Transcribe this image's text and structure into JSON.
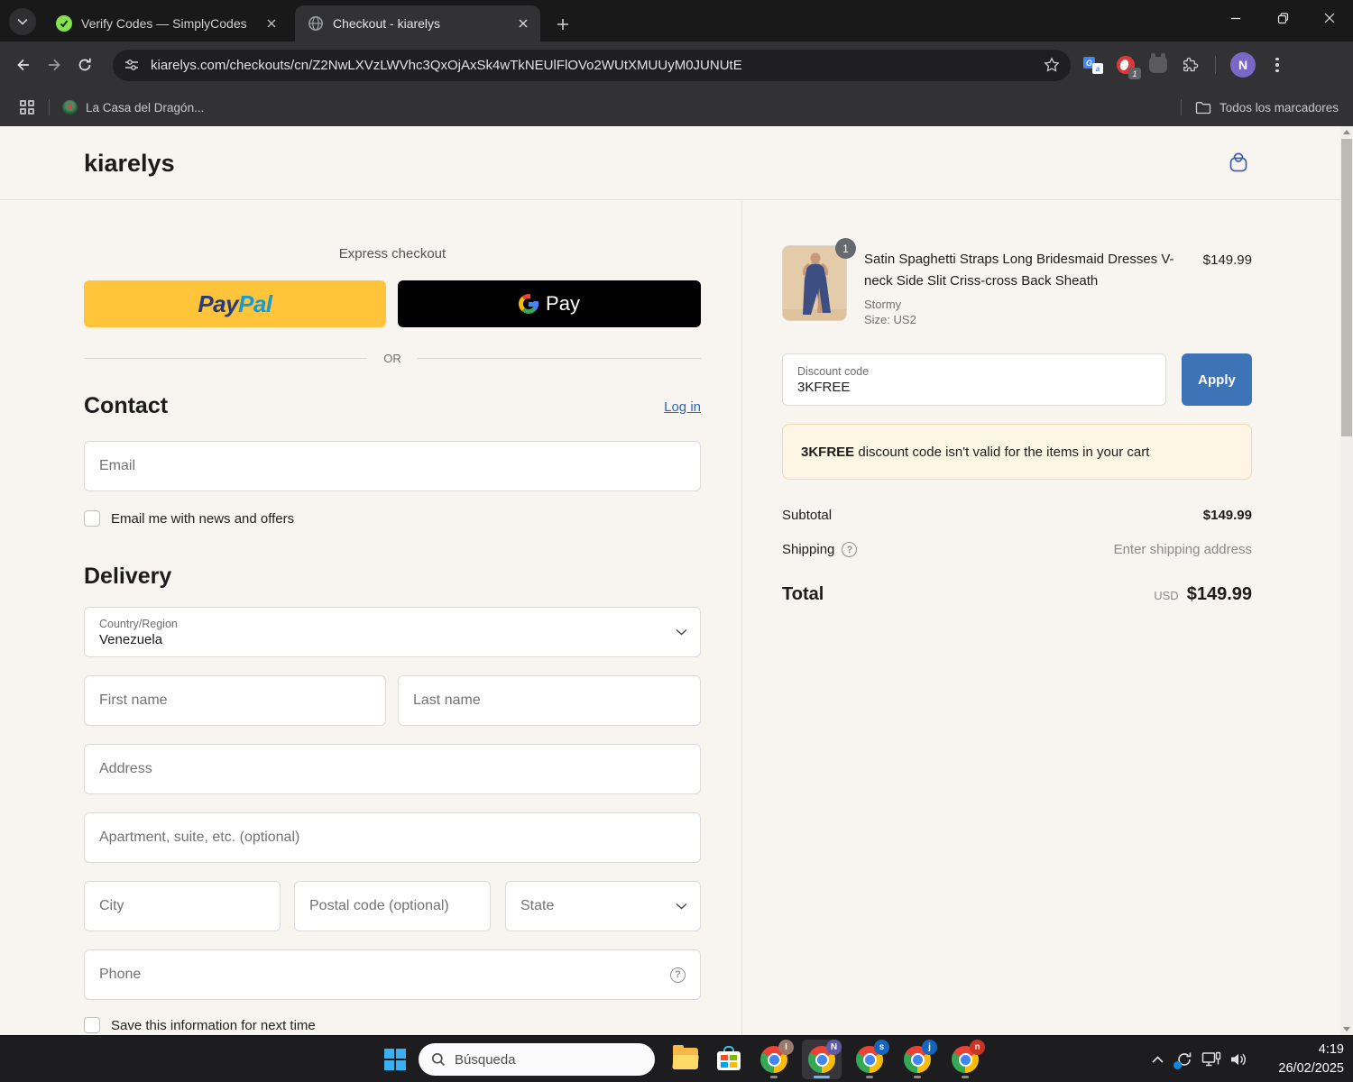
{
  "browser": {
    "tabs": [
      {
        "title": "Verify Codes — SimplyCodes"
      },
      {
        "title": "Checkout - kiarelys"
      }
    ],
    "url": "kiarelys.com/checkouts/cn/Z2NwLXVzLWVhc3QxOjAxSk4wTkNEUlFlOVo2WUtXMUUyM0JUNUtE",
    "extension_badge": "1",
    "profile_initial": "N",
    "bookmarks_bar": {
      "bookmark": "La Casa del Dragón...",
      "all_bookmarks": "Todos los marcadores"
    }
  },
  "page": {
    "store_name": "kiarelys",
    "express": {
      "label": "Express checkout",
      "paypal_pay": "Pay",
      "paypal_pal": "Pal",
      "gpay_text": "Pay",
      "or": "OR"
    },
    "contact": {
      "title": "Contact",
      "login": "Log in",
      "email_placeholder": "Email",
      "newsletter": "Email me with news and offers"
    },
    "delivery": {
      "title": "Delivery",
      "country_label": "Country/Region",
      "country_value": "Venezuela",
      "first_name": "First name",
      "last_name": "Last name",
      "address": "Address",
      "apartment": "Apartment, suite, etc. (optional)",
      "city": "City",
      "postal": "Postal code (optional)",
      "state": "State",
      "phone": "Phone",
      "save_info": "Save this information for next time"
    },
    "summary": {
      "qty": "1",
      "item_title": "Satin Spaghetti Straps Long Bridesmaid Dresses V-neck Side Slit Criss-cross Back Sheath",
      "variant": "Stormy",
      "size": "Size: US2",
      "price": "$149.99",
      "discount_label": "Discount code",
      "discount_value": "3KFREE",
      "apply": "Apply",
      "warning_code": "3KFREE",
      "warning_text": " discount code isn't valid for the items in your cart",
      "subtotal_label": "Subtotal",
      "subtotal": "$149.99",
      "shipping_label": "Shipping",
      "shipping_value": "Enter shipping address",
      "total_label": "Total",
      "currency": "USD",
      "total": "$149.99"
    }
  },
  "taskbar": {
    "search_placeholder": "Búsqueda",
    "time": "4:19",
    "date": "26/02/2025",
    "profiles": [
      "I",
      "N",
      "s",
      "j",
      "n"
    ]
  },
  "icons": {
    "question": "?",
    "translate_g": "G",
    "translate_a": "a"
  },
  "colors": {
    "paypal_yellow": "#ffc439",
    "gpay_black": "#000000",
    "apply_blue": "#3d74b8",
    "link_blue": "#2c66c4",
    "page_bg": "#f8f5f0",
    "warning_bg": "#fdf6e4",
    "warning_border": "#ecdcae",
    "bag_accent": "#3e5fa9"
  }
}
